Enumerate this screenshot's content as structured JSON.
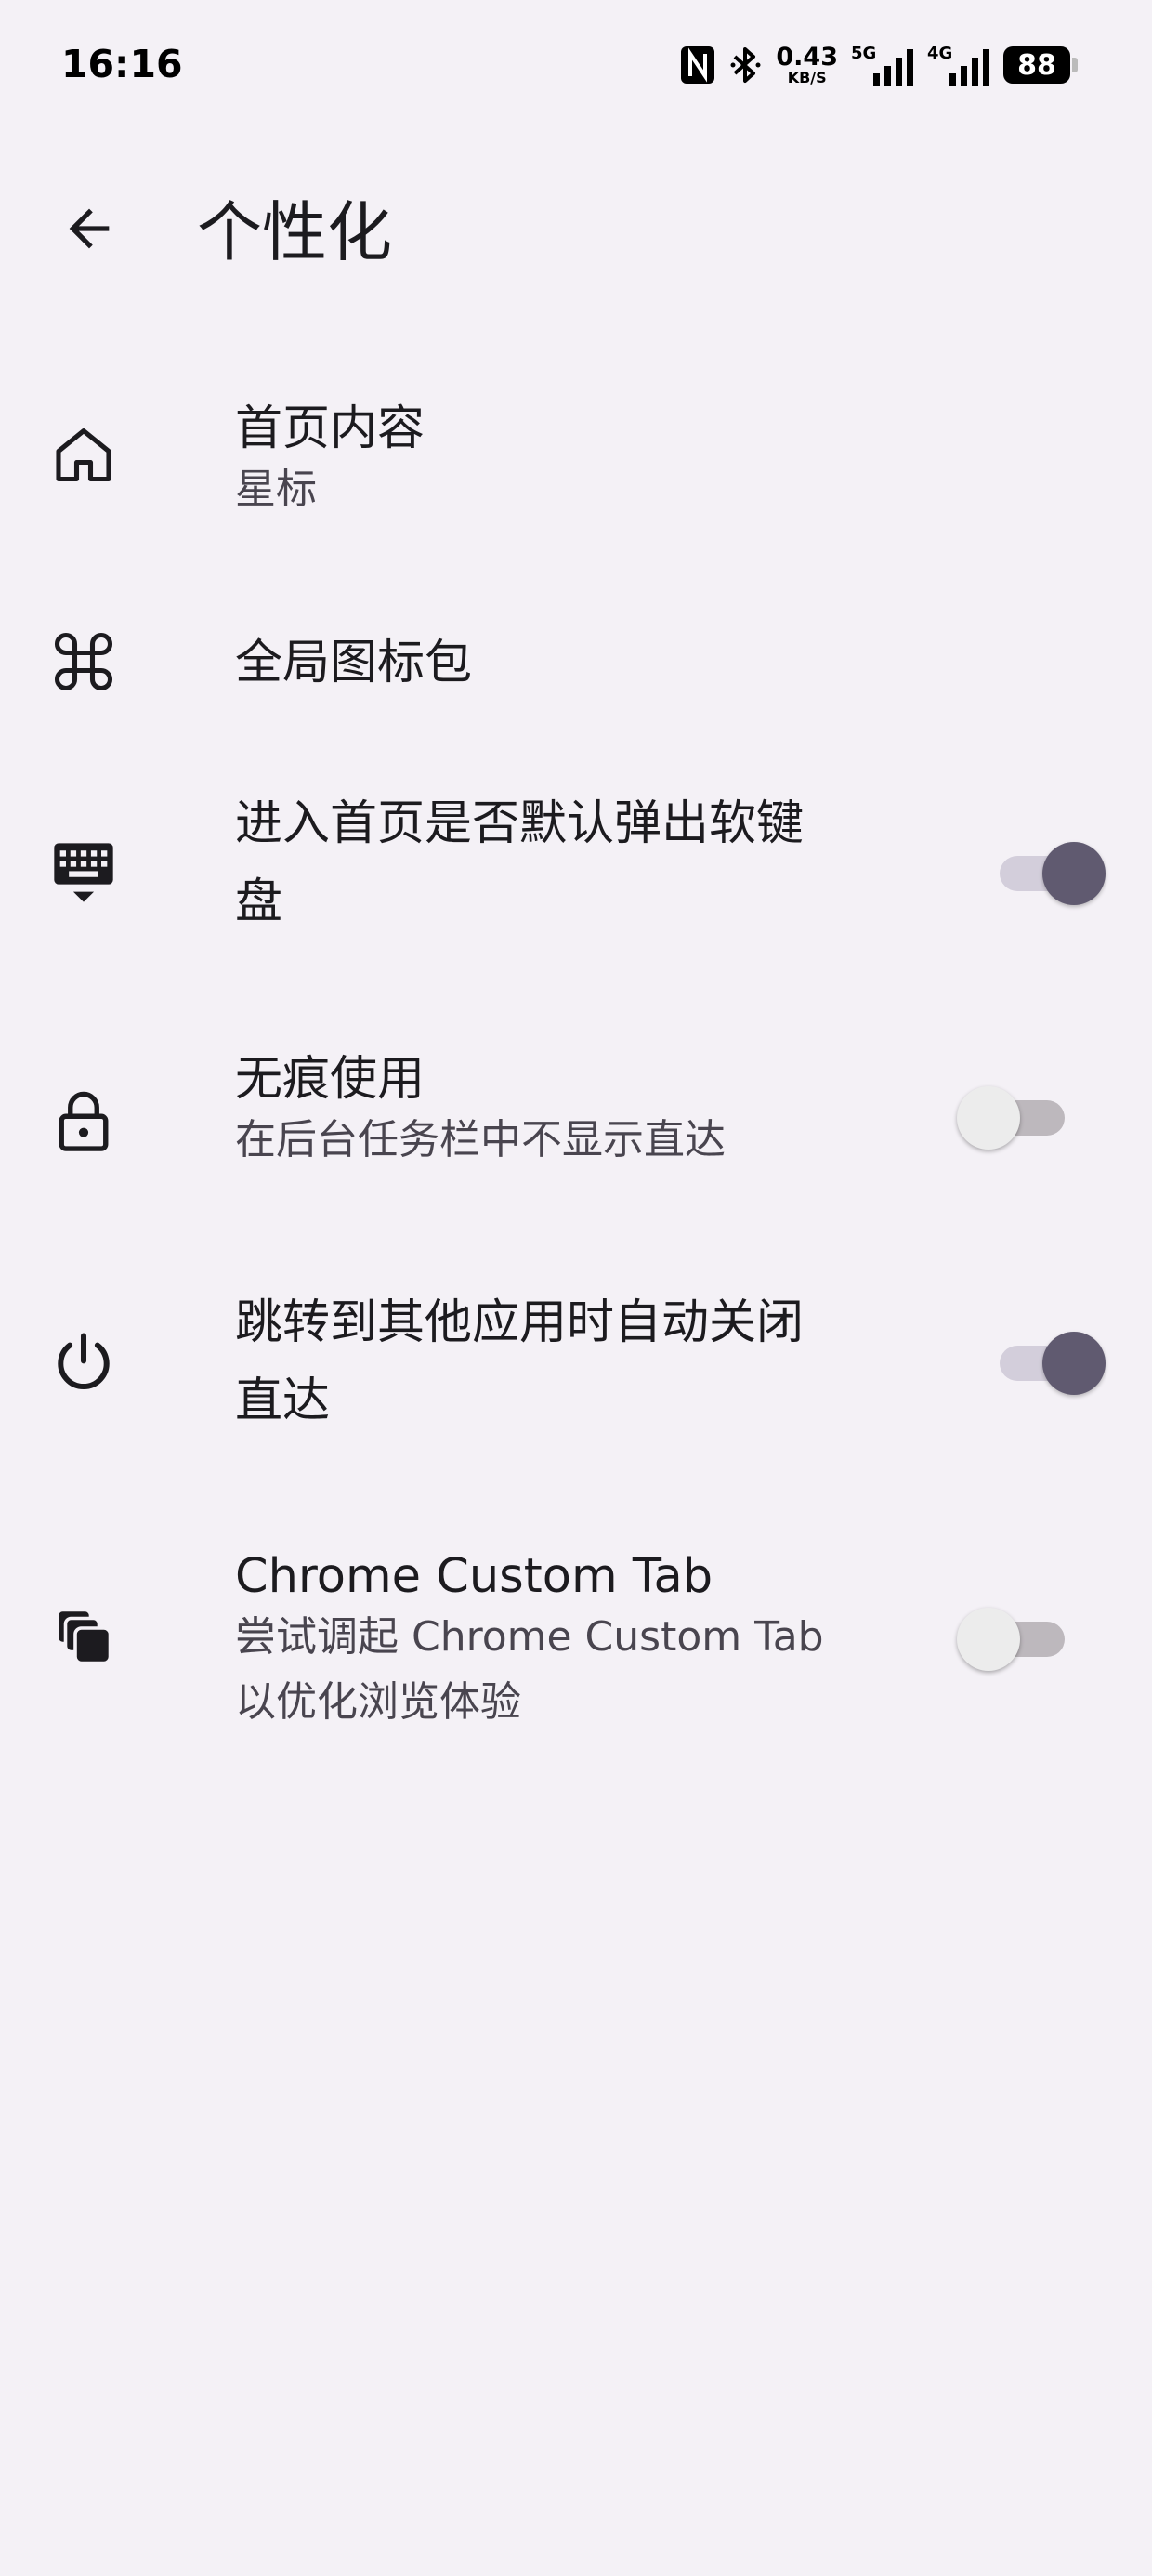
{
  "status_bar": {
    "time": "16:16",
    "net_speed_value": "0.43",
    "net_speed_unit": "KB/S",
    "sim1_label": "5G",
    "sim2_label": "4G",
    "battery_level": "88"
  },
  "header": {
    "title": "个性化"
  },
  "settings": [
    {
      "title": "首页内容",
      "subtitle": "星标",
      "icon": "home-icon"
    },
    {
      "title": "全局图标包",
      "icon": "icon-pack-icon"
    },
    {
      "title_line1": "进入首页是否默认弹出软键",
      "title_line2": "盘",
      "icon": "keyboard-icon",
      "toggle": true
    },
    {
      "title": "无痕使用",
      "subtitle": "在后台任务栏中不显示直达",
      "icon": "lock-icon",
      "toggle": false
    },
    {
      "title_line1": "跳转到其他应用时自动关闭",
      "title_line2": "直达",
      "icon": "power-icon",
      "toggle": true
    },
    {
      "title": "Chrome Custom Tab",
      "subtitle_line1": "尝试调起 Chrome Custom Tab",
      "subtitle_line2": "以优化浏览体验",
      "icon": "tabs-icon",
      "toggle": false
    }
  ],
  "colors": {
    "background": "#f4f1f6",
    "switch_on_thumb": "#605a70",
    "switch_on_track": "#d3cedb",
    "switch_off_thumb": "#ececec",
    "switch_off_track": "#bdb8bd"
  }
}
